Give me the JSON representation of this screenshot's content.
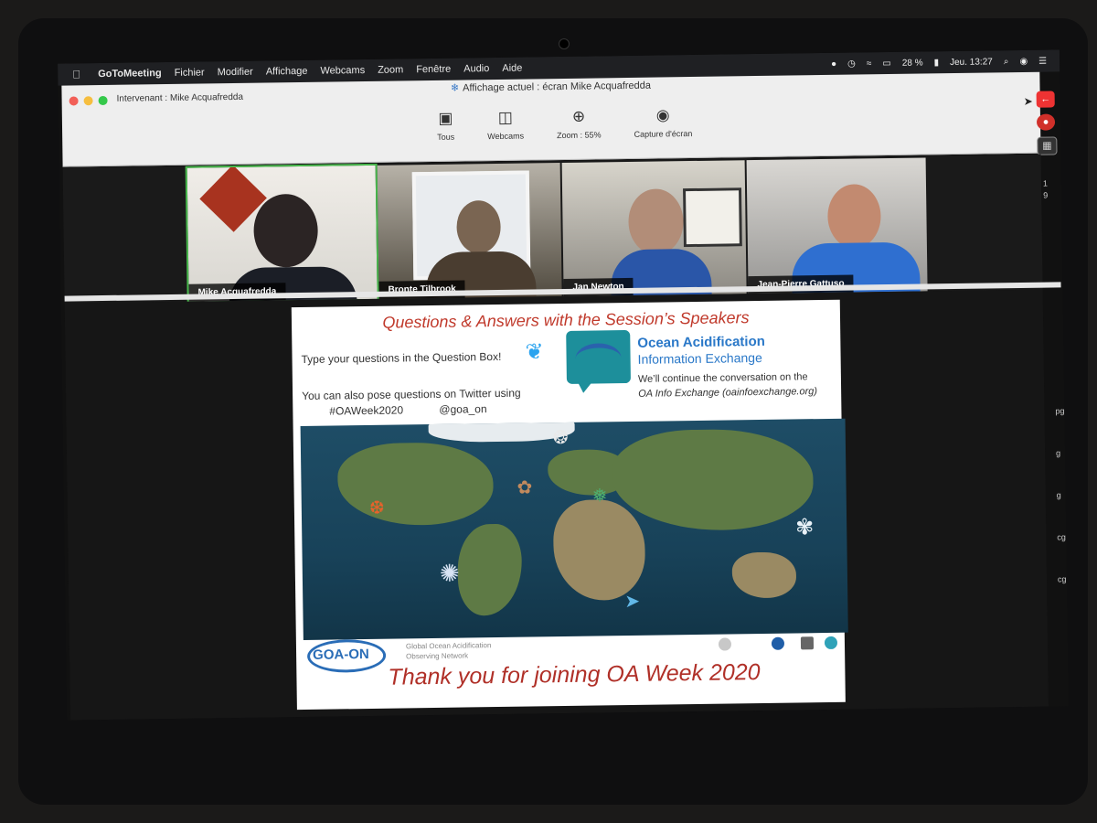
{
  "menubar": {
    "app_name": "GoToMeeting",
    "items": [
      "Fichier",
      "Modifier",
      "Affichage",
      "Webcams",
      "Zoom",
      "Fenêtre",
      "Audio",
      "Aide"
    ],
    "battery": "28 %",
    "clock": "Jeu. 13:27"
  },
  "window": {
    "presenter_label": "Intervenant : Mike Acquafredda",
    "view_title": "Affichage actuel : écran Mike Acquafredda",
    "toolbar": [
      {
        "label": "Tous",
        "icon": "people-grid-icon"
      },
      {
        "label": "Webcams",
        "icon": "video-camera-icon"
      },
      {
        "label": "Zoom : 55%",
        "icon": "zoom-icon"
      },
      {
        "label": "Capture d'écran",
        "icon": "camera-icon"
      }
    ]
  },
  "side_panel": {
    "numbers": [
      "1",
      "9"
    ],
    "marks": [
      "pg",
      "g",
      "g",
      "cg",
      "cg"
    ]
  },
  "cams": [
    {
      "name": "Mike Acquafredda",
      "active": true
    },
    {
      "name": "Bronte Tilbrook",
      "active": false
    },
    {
      "name": "Jan Newton",
      "active": false
    },
    {
      "name": "Jean-Pierre Gattuso",
      "active": false
    }
  ],
  "slide": {
    "title": "Questions & Answers with the Session’s Speakers",
    "question_box": "Type your questions in the Question Box!",
    "twitter_line": "You can also pose questions on Twitter using",
    "hashtag": "#OAWeek2020",
    "handle": "@goa_on",
    "oa_title_1": "Ocean Acidification",
    "oa_title_2": "Information Exchange",
    "oa_note_1": "We’ll continue the conversation on the",
    "oa_note_2": "OA Info Exchange (oainfoexchange.org)",
    "footer_logo": "GOA-ON",
    "footer_sub_1": "Global Ocean Acidification",
    "footer_sub_2": "Observing Network",
    "thanks": "Thank you for joining OA Week 2020"
  },
  "colors": {
    "accent_red": "#c0392b",
    "oa_blue": "#2a78c8",
    "twitter_blue": "#2aa3ef",
    "active_cam": "#48b74c"
  }
}
